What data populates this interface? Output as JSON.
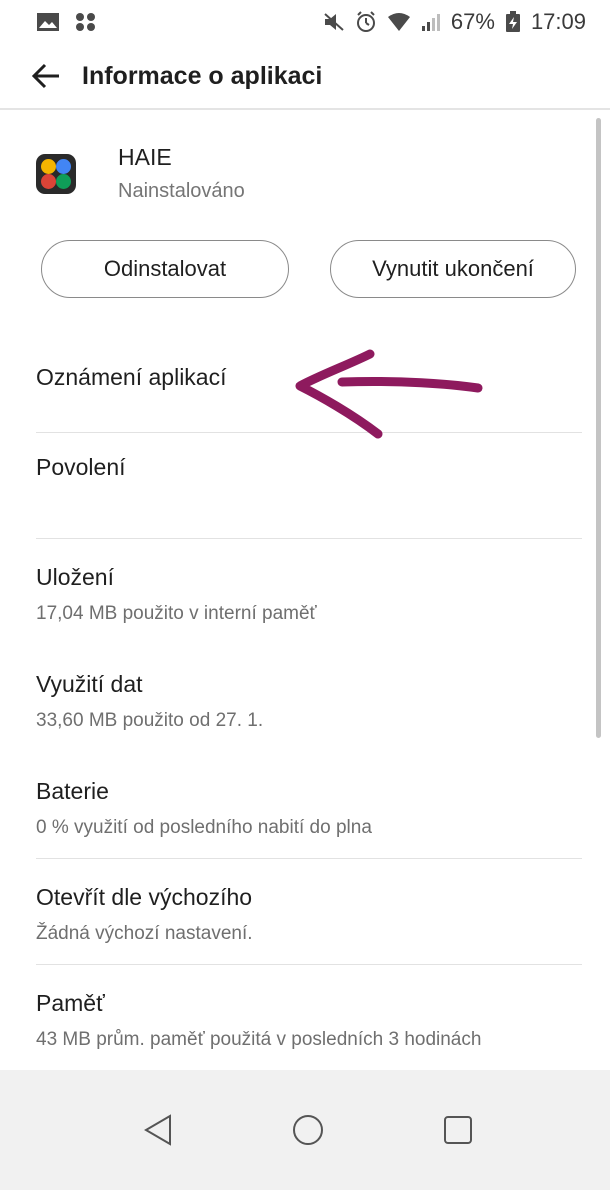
{
  "status_bar": {
    "battery_percent": "67%",
    "time": "17:09",
    "left_icons": [
      "image-notification-icon",
      "apps-grid-icon"
    ],
    "right_icons": [
      "mute-icon",
      "alarm-icon",
      "wifi-icon",
      "signal-icon",
      "battery-icon"
    ]
  },
  "header": {
    "title": "Informace o aplikaci"
  },
  "app": {
    "name": "HAIE",
    "status": "Nainstalováno",
    "icon_colors": [
      "#f4b400",
      "#4285f4",
      "#db4437",
      "#0f9d58"
    ]
  },
  "buttons": {
    "uninstall": "Odinstalovat",
    "force_stop": "Vynutit ukončení"
  },
  "items": [
    {
      "title": "Oznámení aplikací",
      "subtitle": ""
    },
    {
      "title": "Povolení",
      "subtitle": ""
    },
    {
      "title": "Uložení",
      "subtitle": "17,04 MB použito v interní paměť"
    },
    {
      "title": "Využití dat",
      "subtitle": "33,60 MB použito od 27. 1."
    },
    {
      "title": "Baterie",
      "subtitle": "0 % využití od posledního nabití do plna"
    },
    {
      "title": "Otevřít dle výchozího",
      "subtitle": "Žádná výchozí nastavení."
    },
    {
      "title": "Paměť",
      "subtitle": "43 MB prům. paměť použitá v posledních 3 hodinách"
    }
  ],
  "annotation": {
    "color": "#8e1a5e"
  },
  "nav_bar": {
    "buttons": [
      "back-triangle-icon",
      "home-circle-icon",
      "recents-square-icon"
    ]
  }
}
